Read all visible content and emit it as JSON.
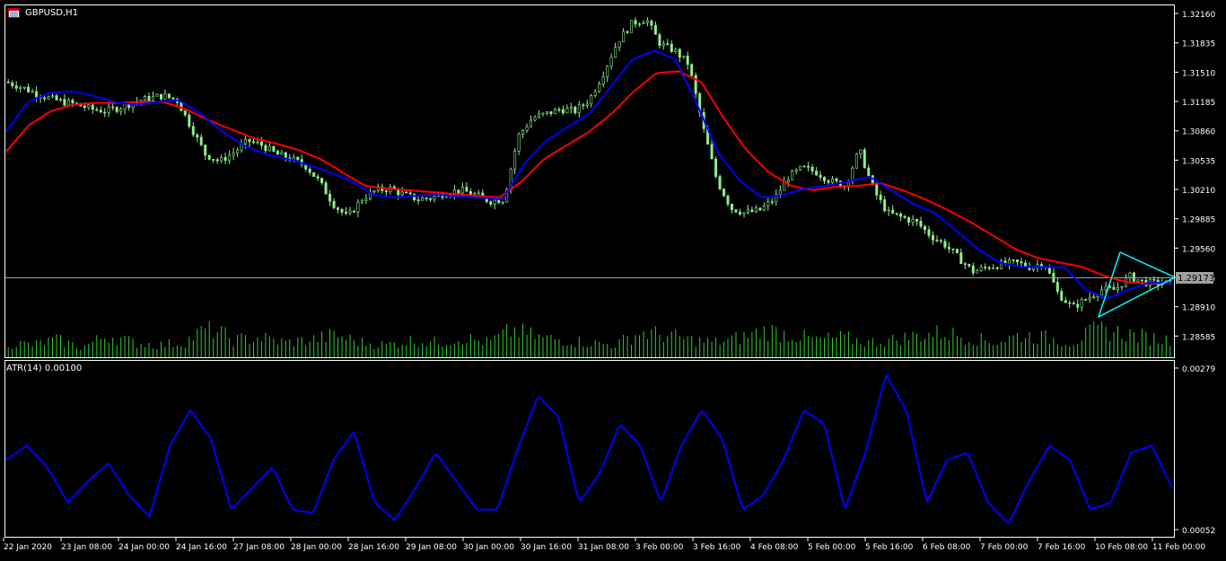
{
  "header": {
    "symbol_timeframe": "GBPUSD,H1",
    "atr_label": "ATR(14) 0.00100"
  },
  "price_axis": {
    "ticks": [
      "1.32160",
      "1.31835",
      "1.31510",
      "1.31185",
      "1.30860",
      "1.30535",
      "1.30210",
      "1.29885",
      "1.29560",
      "1.29235",
      "1.28910",
      "1.28585"
    ],
    "current_price": "1.29173"
  },
  "atr_axis": {
    "ticks": [
      "0.00279",
      "0.00052"
    ]
  },
  "time_axis": {
    "ticks": [
      "22 Jan 2020",
      "23 Jan 08:00",
      "24 Jan 00:00",
      "24 Jan 16:00",
      "27 Jan 08:00",
      "28 Jan 00:00",
      "28 Jan 16:00",
      "29 Jan 08:00",
      "30 Jan 00:00",
      "30 Jan 16:00",
      "31 Jan 08:00",
      "3 Feb 00:00",
      "3 Feb 16:00",
      "4 Feb 08:00",
      "5 Feb 00:00",
      "5 Feb 16:00",
      "6 Feb 08:00",
      "7 Feb 00:00",
      "7 Feb 16:00",
      "10 Feb 08:00",
      "11 Feb 00:00"
    ]
  },
  "colors": {
    "background": "#000000",
    "candles": "#90ee90",
    "ma_fast": "#0000ff",
    "ma_slow": "#ff0000",
    "atr_line": "#0000ff",
    "volumes": "#32cd32",
    "triangle": "#00ffff",
    "axis": "#ffffff",
    "price_line": "#a0a0a0"
  },
  "chart_data": {
    "type": "line",
    "price_ylim": [
      1.2835,
      1.3225
    ],
    "atr_ylim": [
      0.00052,
      0.00279
    ],
    "close_keypoints": [
      1.314,
      1.3135,
      1.3128,
      1.3122,
      1.3118,
      1.3115,
      1.311,
      1.3108,
      1.3112,
      1.3118,
      1.3122,
      1.3125,
      1.312,
      1.309,
      1.306,
      1.3052,
      1.3062,
      1.3075,
      1.307,
      1.306,
      1.3055,
      1.3048,
      1.303,
      1.3005,
      1.299,
      1.301,
      1.302,
      1.3022,
      1.3015,
      1.301,
      1.3012,
      1.3018,
      1.302,
      1.3015,
      1.3008,
      1.301,
      1.308,
      1.31,
      1.3105,
      1.311,
      1.3108,
      1.312,
      1.315,
      1.3185,
      1.3205,
      1.321,
      1.3182,
      1.3175,
      1.316,
      1.309,
      1.303,
      1.3,
      1.2995,
      1.2998,
      1.301,
      1.3035,
      1.3045,
      1.304,
      1.303,
      1.3025,
      1.3065,
      1.302,
      1.2995,
      1.299,
      1.2985,
      1.297,
      1.296,
      1.2945,
      1.293,
      1.2935,
      1.2938,
      1.294,
      1.2935,
      1.294,
      1.2905,
      1.289,
      1.29,
      1.291,
      1.291,
      1.2925,
      1.2918,
      1.2917,
      1.2917
    ],
    "ma_fast_keypoints": [
      1.3085,
      1.3118,
      1.3128,
      1.313,
      1.3125,
      1.3118,
      1.3115,
      1.3118,
      1.312,
      1.3105,
      1.3085,
      1.307,
      1.306,
      1.3055,
      1.3048,
      1.304,
      1.303,
      1.3015,
      1.3012,
      1.3014,
      1.3015,
      1.3013,
      1.3012,
      1.301,
      1.305,
      1.3075,
      1.309,
      1.3105,
      1.3135,
      1.3165,
      1.3175,
      1.3165,
      1.3115,
      1.306,
      1.303,
      1.3012,
      1.3015,
      1.3022,
      1.3025,
      1.303,
      1.3035,
      1.302,
      1.3005,
      1.2995,
      1.2975,
      1.2955,
      1.294,
      1.2935,
      1.2935,
      1.2935,
      1.291,
      1.29,
      1.291,
      1.2918,
      1.2917
    ],
    "ma_slow_keypoints": [
      1.3063,
      1.3092,
      1.3108,
      1.3115,
      1.3117,
      1.3117,
      1.3118,
      1.3118,
      1.311,
      1.3098,
      1.3088,
      1.3078,
      1.3072,
      1.3065,
      1.3055,
      1.304,
      1.3025,
      1.3022,
      1.302,
      1.3018,
      1.3016,
      1.3014,
      1.3012,
      1.303,
      1.3055,
      1.307,
      1.3085,
      1.3105,
      1.313,
      1.315,
      1.3152,
      1.314,
      1.31,
      1.3065,
      1.304,
      1.3025,
      1.302,
      1.3024,
      1.3025,
      1.3028,
      1.302,
      1.301,
      1.2998,
      1.2985,
      1.297,
      1.2955,
      1.2945,
      1.294,
      1.2935,
      1.2925,
      1.2918,
      1.2917,
      1.2917
    ],
    "atr_keypoints": [
      0.0015,
      0.0017,
      0.0014,
      0.0009,
      0.0012,
      0.00145,
      0.001,
      0.0007,
      0.0017,
      0.0022,
      0.0018,
      0.0008,
      0.0011,
      0.0014,
      0.0008,
      0.00075,
      0.0015,
      0.0019,
      0.0009,
      0.00065,
      0.0011,
      0.0016,
      0.0012,
      0.0008,
      0.0008,
      0.00165,
      0.0024,
      0.0021,
      0.0009,
      0.0013,
      0.002,
      0.0017,
      0.0009,
      0.0017,
      0.0022,
      0.0018,
      0.0008,
      0.001,
      0.0015,
      0.0022,
      0.002,
      0.0008,
      0.0016,
      0.0027,
      0.0022,
      0.0009,
      0.0015,
      0.0016,
      0.0009,
      0.0006,
      0.0012,
      0.0017,
      0.0015,
      0.0008,
      0.0009,
      0.0016,
      0.0017,
      0.0011
    ],
    "volume_keypoints": [
      0.3,
      0.25,
      0.35,
      0.2,
      0.45,
      0.3,
      0.25,
      0.3,
      0.6,
      0.35,
      0.4,
      0.3,
      0.35,
      0.45,
      0.3,
      0.25,
      0.35,
      0.3,
      0.4,
      0.3,
      0.55,
      0.4,
      0.35,
      0.3,
      0.25,
      0.5,
      0.45,
      0.35,
      0.3,
      0.4,
      0.55,
      0.45,
      0.35,
      0.4,
      0.3,
      0.35,
      0.45,
      0.5,
      0.4,
      0.3,
      0.45,
      0.4,
      0.3,
      0.55,
      0.5,
      0.4,
      0.35
    ]
  }
}
